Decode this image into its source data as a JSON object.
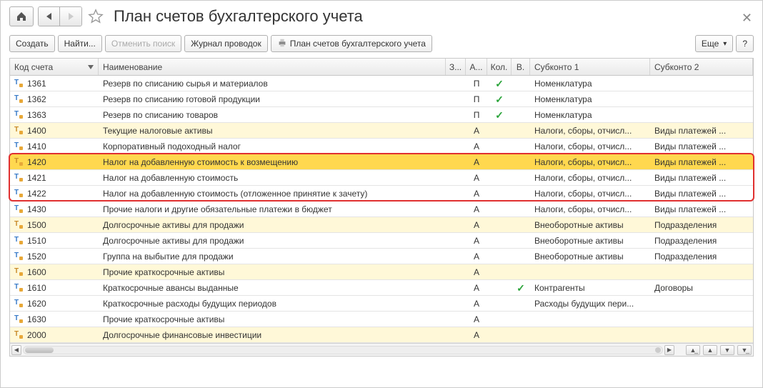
{
  "header": {
    "title": "План счетов бухгалтерского учета"
  },
  "toolbar": {
    "create": "Создать",
    "find": "Найти...",
    "cancel_search": "Отменить поиск",
    "journal": "Журнал проводок",
    "print": "План счетов бухгалтерского учета",
    "more": "Еще",
    "help": "?"
  },
  "columns": {
    "code": "Код счета",
    "name": "Наименование",
    "z": "З...",
    "a": "А...",
    "kol": "Кол.",
    "v": "В.",
    "sub1": "Субконто 1",
    "sub2": "Субконто 2"
  },
  "rows": [
    {
      "code": "1361",
      "name": "Резерв по списанию сырья и материалов",
      "z": "",
      "a": "П",
      "kol": true,
      "v": "",
      "sub1": "Номенклатура",
      "sub2": "",
      "group": false
    },
    {
      "code": "1362",
      "name": "Резерв по списанию готовой продукции",
      "z": "",
      "a": "П",
      "kol": true,
      "v": "",
      "sub1": "Номенклатура",
      "sub2": "",
      "group": false
    },
    {
      "code": "1363",
      "name": "Резерв по списанию товаров",
      "z": "",
      "a": "П",
      "kol": true,
      "v": "",
      "sub1": "Номенклатура",
      "sub2": "",
      "group": false
    },
    {
      "code": "1400",
      "name": "Текущие налоговые активы",
      "z": "",
      "a": "А",
      "kol": false,
      "v": "",
      "sub1": "Налоги, сборы, отчисл...",
      "sub2": "Виды платежей ...",
      "group": true
    },
    {
      "code": "1410",
      "name": "Корпоративный подоходный налог",
      "z": "",
      "a": "А",
      "kol": false,
      "v": "",
      "sub1": "Налоги, сборы, отчисл...",
      "sub2": "Виды платежей ...",
      "group": false
    },
    {
      "code": "1420",
      "name": "Налог на добавленную стоимость к возмещению",
      "z": "",
      "a": "А",
      "kol": false,
      "v": "",
      "sub1": "Налоги, сборы, отчисл...",
      "sub2": "Виды платежей ...",
      "group": true,
      "selected": true
    },
    {
      "code": "1421",
      "name": "Налог на добавленную стоимость",
      "z": "",
      "a": "А",
      "kol": false,
      "v": "",
      "sub1": "Налоги, сборы, отчисл...",
      "sub2": "Виды платежей ...",
      "group": false
    },
    {
      "code": "1422",
      "name": "Налог на добавленную стоимость (отложенное принятие к зачету)",
      "z": "",
      "a": "А",
      "kol": false,
      "v": "",
      "sub1": "Налоги, сборы, отчисл...",
      "sub2": "Виды платежей ...",
      "group": false
    },
    {
      "code": "1430",
      "name": "Прочие налоги и другие обязательные платежи в бюджет",
      "z": "",
      "a": "А",
      "kol": false,
      "v": "",
      "sub1": "Налоги, сборы, отчисл...",
      "sub2": "Виды платежей ...",
      "group": false
    },
    {
      "code": "1500",
      "name": "Долгосрочные активы для продажи",
      "z": "",
      "a": "А",
      "kol": false,
      "v": "",
      "sub1": "Внеоборотные активы",
      "sub2": "Подразделения",
      "group": true
    },
    {
      "code": "1510",
      "name": "Долгосрочные активы для продажи",
      "z": "",
      "a": "А",
      "kol": false,
      "v": "",
      "sub1": "Внеоборотные активы",
      "sub2": "Подразделения",
      "group": false
    },
    {
      "code": "1520",
      "name": "Группа на выбытие для продажи",
      "z": "",
      "a": "А",
      "kol": false,
      "v": "",
      "sub1": "Внеоборотные активы",
      "sub2": "Подразделения",
      "group": false
    },
    {
      "code": "1600",
      "name": "Прочие краткосрочные активы",
      "z": "",
      "a": "А",
      "kol": false,
      "v": "",
      "sub1": "",
      "sub2": "",
      "group": true
    },
    {
      "code": "1610",
      "name": "Краткосрочные авансы выданные",
      "z": "",
      "a": "А",
      "kol": false,
      "v": true,
      "sub1": "Контрагенты",
      "sub2": "Договоры",
      "group": false
    },
    {
      "code": "1620",
      "name": "Краткосрочные расходы будущих периодов",
      "z": "",
      "a": "А",
      "kol": false,
      "v": "",
      "sub1": "Расходы будущих пери...",
      "sub2": "",
      "group": false
    },
    {
      "code": "1630",
      "name": "Прочие краткосрочные активы",
      "z": "",
      "a": "А",
      "kol": false,
      "v": "",
      "sub1": "",
      "sub2": "",
      "group": false
    },
    {
      "code": "2000",
      "name": "Долгосрочные финансовые инвестиции",
      "z": "",
      "a": "А",
      "kol": false,
      "v": "",
      "sub1": "",
      "sub2": "",
      "group": true
    }
  ],
  "highlight": {
    "from": 5,
    "to": 7
  }
}
